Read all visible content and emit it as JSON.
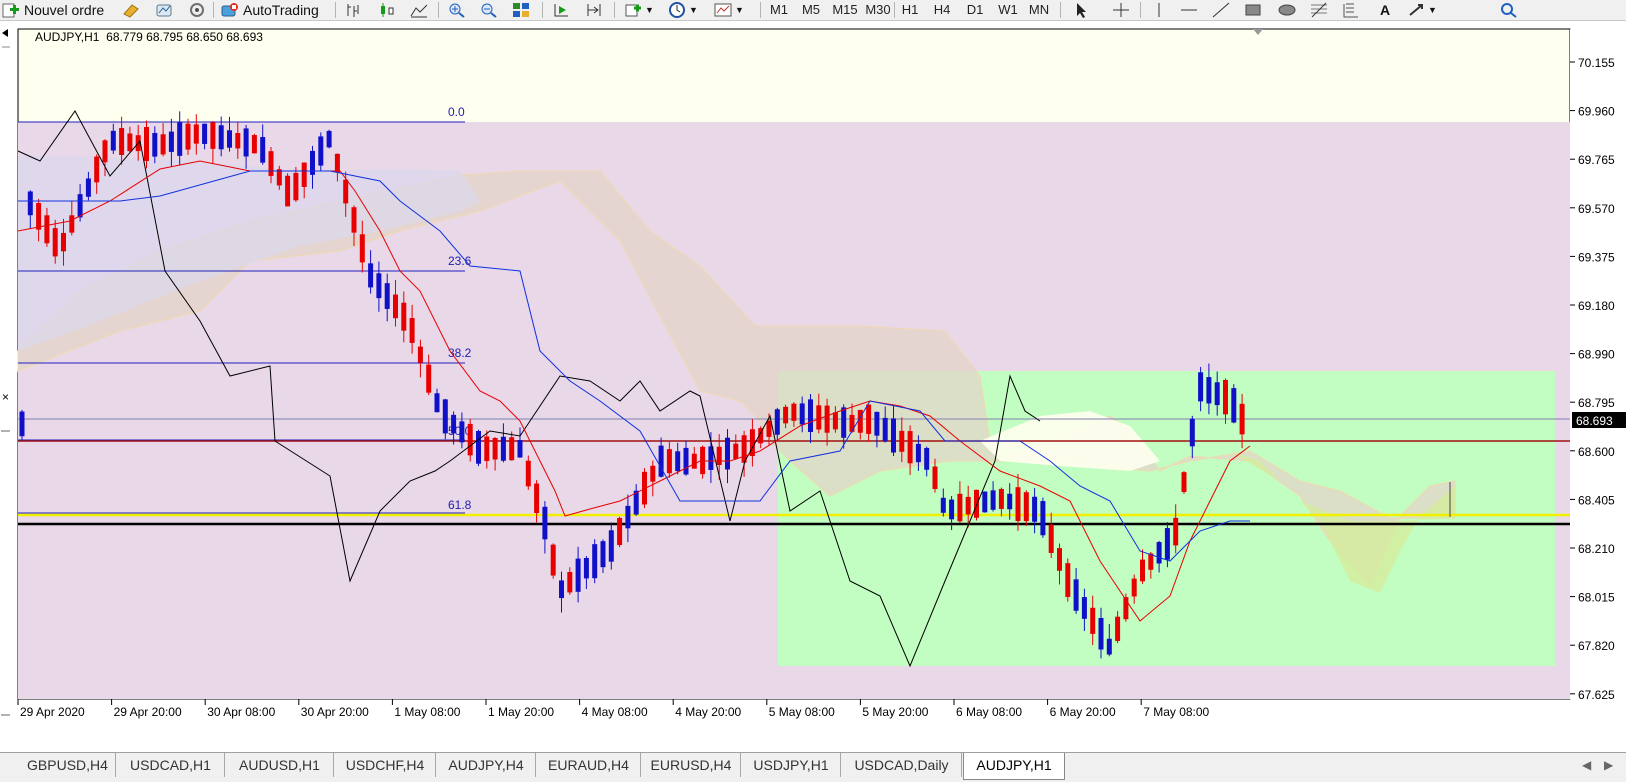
{
  "toolbar": {
    "new_order_label": "Nouvel ordre",
    "autotrading_label": "AutoTrading",
    "timeframes": [
      "M1",
      "M5",
      "M15",
      "M30",
      "H1",
      "H4",
      "D1",
      "W1",
      "MN"
    ],
    "active_timeframe": "H1"
  },
  "chart": {
    "header": "AUDJPY,H1  68.779 68.795 68.650 68.693",
    "current_price_label": "68.693",
    "price_axis": [
      "70.155",
      "69.960",
      "69.765",
      "69.570",
      "69.375",
      "69.180",
      "68.990",
      "68.795",
      "68.600",
      "68.405",
      "68.210",
      "68.015",
      "67.820",
      "67.625"
    ],
    "time_axis": [
      "29 Apr 2020",
      "29 Apr 20:00",
      "30 Apr 08:00",
      "30 Apr 20:00",
      "1 May 08:00",
      "1 May 20:00",
      "4 May 08:00",
      "4 May 20:00",
      "5 May 08:00",
      "5 May 20:00",
      "6 May 08:00",
      "6 May 20:00",
      "7 May 08:00"
    ],
    "fib_levels": [
      "0.0",
      "23.6",
      "38.2",
      "50.0",
      "61.8"
    ],
    "colors": {
      "bull": "#1010c8",
      "bear": "#e80000",
      "background": "#fffff0",
      "fib_zone": "#e8d8e8",
      "rect_zone": "#c0ffc0",
      "kijun": "#1030e0",
      "tenkan": "#e80000",
      "chikou": "#000000"
    }
  },
  "tabs": [
    "GBPUSD,H4",
    "USDCAD,H1",
    "AUDUSD,H1",
    "USDCHF,H4",
    "AUDJPY,H4",
    "EURAUD,H4",
    "EURUSD,H4",
    "USDJPY,H1",
    "USDCAD,Daily",
    "AUDJPY,H1"
  ],
  "active_tab": "AUDJPY,H1"
}
